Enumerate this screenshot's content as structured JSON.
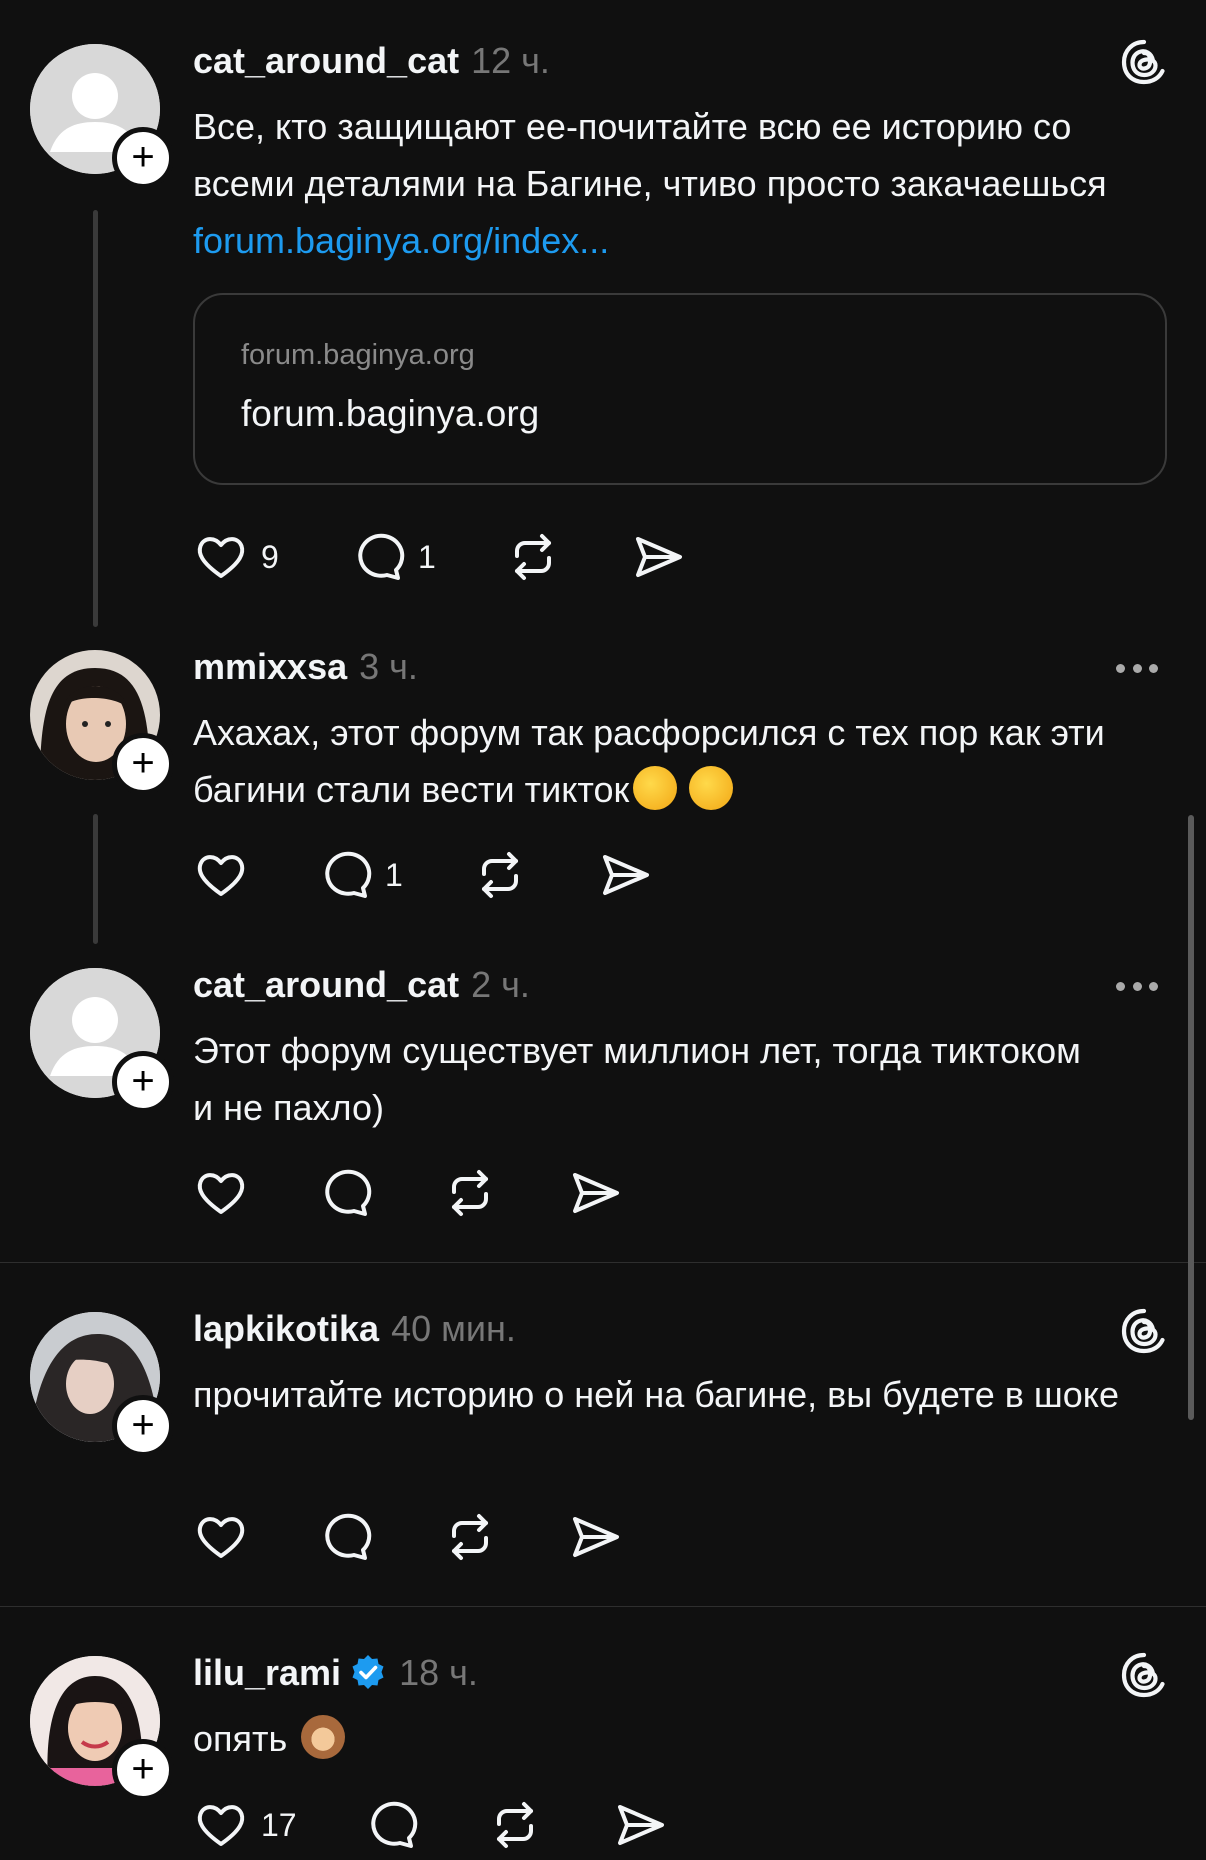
{
  "posts": [
    {
      "username": "cat_around_cat",
      "time": "12 ч.",
      "text": "Все, кто защищают ее-почитайте всю ее историю со всеми деталями на Багине, чтиво просто закачаешься ",
      "link": "forum.baginya.org/index...",
      "card": {
        "domain": "forum.baginya.org",
        "title": "forum.baginya.org"
      },
      "likes": "9",
      "replies": "1",
      "corner_icon": "threads-logo-icon"
    },
    {
      "username": "mmixxsa",
      "time": "3 ч.",
      "text": "Ахахах, этот форум так расфорсился с тех пор как эти багини стали вести тикток",
      "likes": "",
      "replies": "1",
      "corner_icon": "more-icon"
    },
    {
      "username": "cat_around_cat",
      "time": "2 ч.",
      "text": "Этот форум существует миллион лет, тогда тиктоком и не пахло)",
      "likes": "",
      "replies": "",
      "corner_icon": "more-icon"
    },
    {
      "username": "lapkikotika",
      "time": "40 мин.",
      "text": "прочитайте историю о ней на багине, вы будете в шоке",
      "likes": "",
      "replies": "",
      "corner_icon": "threads-logo-icon"
    },
    {
      "username": "lilu_rami",
      "time": "18 ч.",
      "text": "опять ",
      "likes": "17",
      "replies": "",
      "verified": true,
      "corner_icon": "threads-logo-icon"
    }
  ],
  "icons": {
    "like": "heart-icon",
    "reply": "comment-icon",
    "repost": "repost-icon",
    "share": "send-icon",
    "follow": "plus-icon"
  },
  "colors": {
    "background": "#101010",
    "link": "#1d9bf0",
    "verified": "#1d9bf0"
  }
}
